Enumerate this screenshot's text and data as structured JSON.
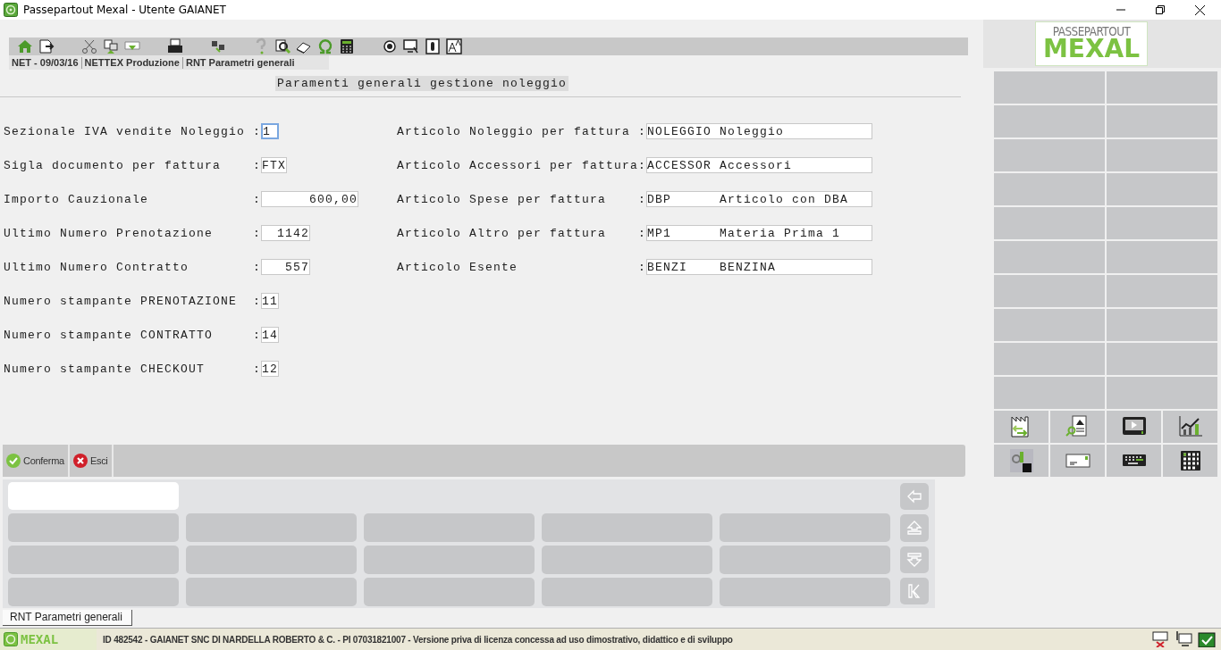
{
  "window": {
    "title": "Passepartout Mexal - Utente GAIANET"
  },
  "breadcrumb": [
    "NET - 09/03/16",
    "NETTEX Produzione",
    "RNT  Parametri generali"
  ],
  "heading": "Paramenti generali gestione noleggio",
  "left_fields": [
    {
      "label": "Sezionale IVA vendite Noleggio :",
      "value": "1",
      "kind": "short",
      "focused": true
    },
    {
      "label": "Sigla documento per fattura    :",
      "value": "FTX",
      "kind": "code",
      "focused": false
    },
    {
      "label": "Importo Cauzionale             :",
      "value": "600,00",
      "kind": "amount",
      "focused": false
    },
    {
      "label": "Ultimo Numero Prenotazione     :",
      "value": "1142",
      "kind": "number",
      "focused": false
    },
    {
      "label": "Ultimo Numero Contratto        :",
      "value": "557",
      "kind": "number",
      "focused": false
    },
    {
      "label": "Numero stampante PRENOTAZIONE  :",
      "value": "11",
      "kind": "short",
      "focused": false
    },
    {
      "label": "Numero stampante CONTRATTO     :",
      "value": "14",
      "kind": "short",
      "focused": false
    },
    {
      "label": "Numero stampante CHECKOUT      :",
      "value": "12",
      "kind": "short",
      "focused": false
    }
  ],
  "right_fields": [
    {
      "label": "Articolo Noleggio per fattura :",
      "value": "NOLEGGIO Noleggio",
      "kind": "article",
      "focused": false
    },
    {
      "label": "Articolo Accessori per fattura:",
      "value": "ACCESSOR Accessori",
      "kind": "article",
      "focused": false
    },
    {
      "label": "Articolo Spese per fattura    :",
      "value": "DBP      Articolo con DBA",
      "kind": "article",
      "focused": false
    },
    {
      "label": "Articolo Altro per fattura    :",
      "value": "MP1      Materia Prima 1",
      "kind": "article",
      "focused": false
    },
    {
      "label": "Articolo Esente               :",
      "value": "BENZI    BENZINA",
      "kind": "article",
      "focused": false
    }
  ],
  "logo": {
    "line_1": "PASSEPARTOUT",
    "line_2": "MEXAL"
  },
  "commands": [
    {
      "label": "Conferma",
      "kind": "confirm"
    },
    {
      "label": "Esci",
      "kind": "cancel"
    }
  ],
  "tab": {
    "label": "RNT  Parametri generali"
  },
  "status_bar": {
    "brand": "MEXAL",
    "text": "ID 482542 - GAIANET SNC DI NARDELLA ROBERTO & C. - PI 07031821007 - Versione priva di licenza concessa ad uso dimostrativo, didattico e di sviluppo"
  }
}
